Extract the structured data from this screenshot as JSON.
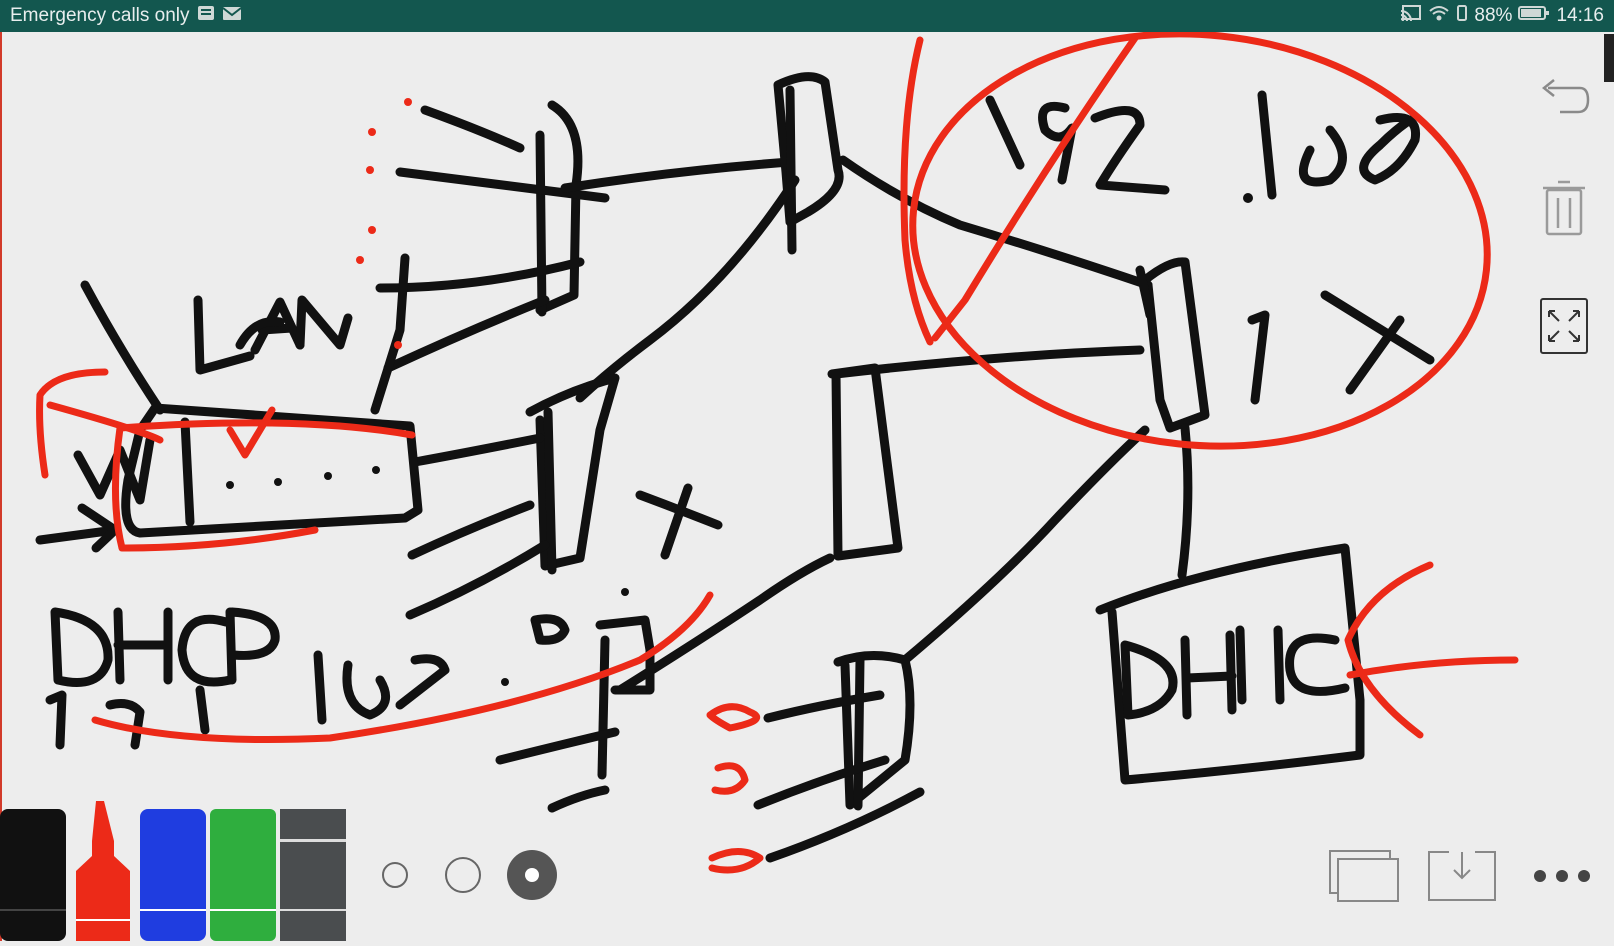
{
  "status_bar": {
    "left_text": "Emergency calls only",
    "battery_level": "88%",
    "time": "14:16",
    "icons": [
      "sim-icon",
      "mail-icon",
      "cast-icon",
      "wifi-icon",
      "vibrate-icon",
      "battery-icon"
    ]
  },
  "drawing": {
    "handwritten_text": [
      "LAN",
      "DHCP",
      "192.168",
      "192.168",
      "1X",
      "X",
      "DHCP"
    ],
    "ink_colors": {
      "black": "#111111",
      "red": "#ec2a18"
    }
  },
  "toolbar_right": {
    "undo_icon": "undo-icon",
    "delete_icon": "trash-icon",
    "fullscreen_icon": "fullscreen-icon"
  },
  "pens": [
    {
      "name": "black-marker",
      "color": "#111111",
      "selected": false
    },
    {
      "name": "red-marker",
      "color": "#ec2a18",
      "selected": true
    },
    {
      "name": "blue-marker",
      "color": "#1f3de0",
      "selected": false
    },
    {
      "name": "green-marker",
      "color": "#2fae3e",
      "selected": false
    },
    {
      "name": "eraser",
      "color": "#4a4d4f",
      "selected": false
    }
  ],
  "stroke_sizes": [
    "small",
    "medium",
    "large"
  ],
  "selected_stroke_size": "large",
  "bottom_actions": {
    "windows_icon": "multi-window-icon",
    "save_icon": "download-icon",
    "more_icon": "more-icon"
  }
}
